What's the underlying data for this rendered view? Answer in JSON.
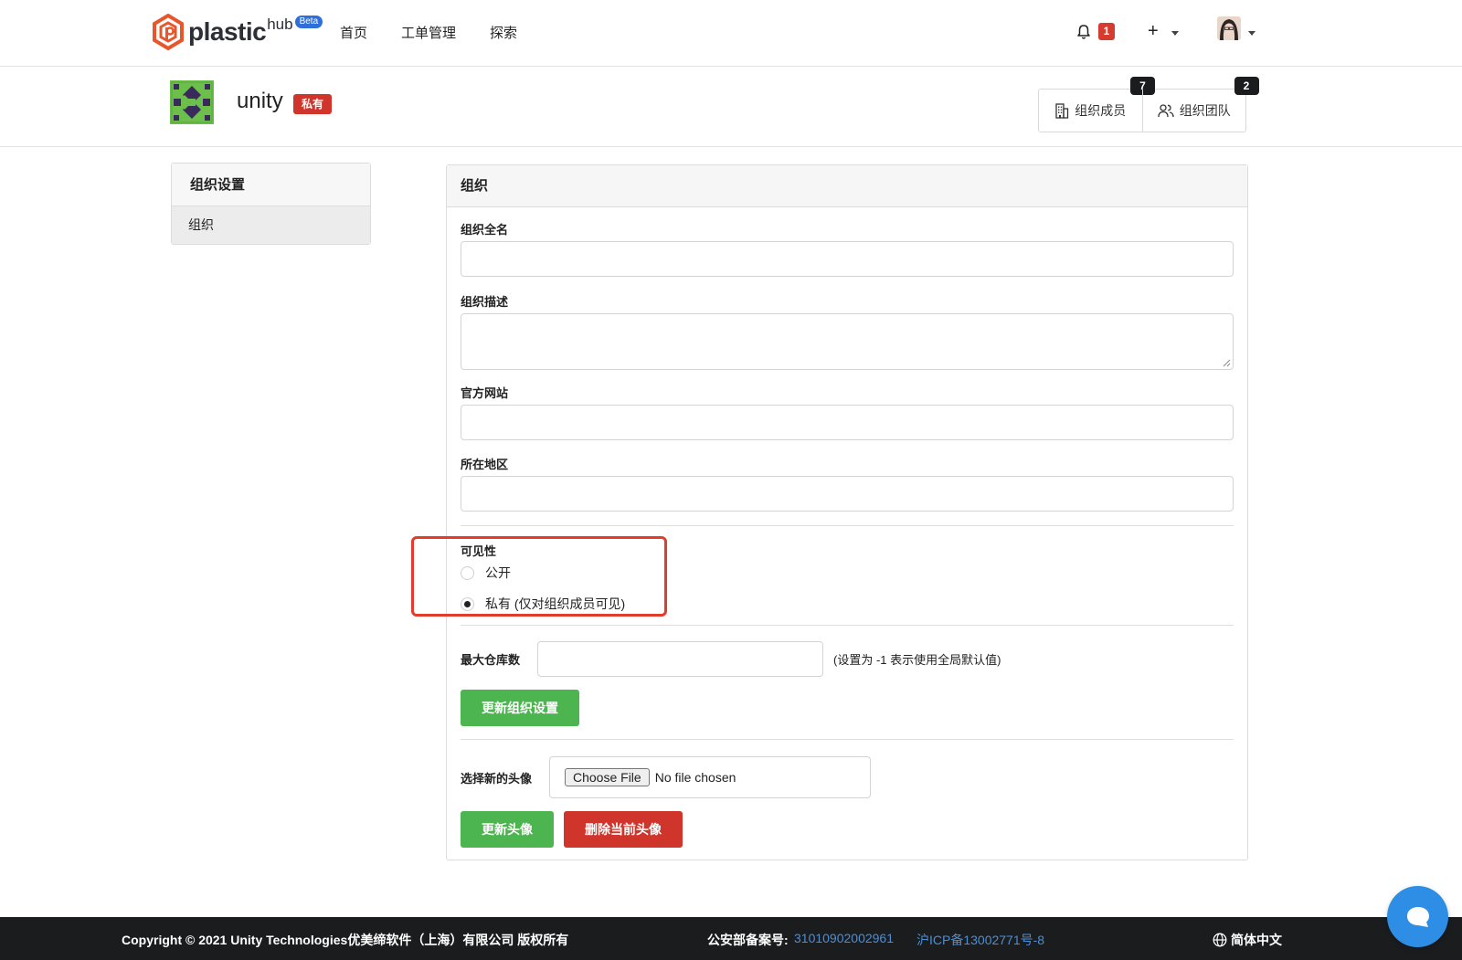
{
  "nav": {
    "logo_text": "plastic",
    "logo_hub": "hub",
    "logo_beta": "Beta",
    "links": [
      "首页",
      "工单管理",
      "探索"
    ],
    "notification_count": "1",
    "plus_symbol": "+"
  },
  "org": {
    "name": "unity",
    "visibility_badge": "私有",
    "members_label": "组织成员",
    "members_count": "7",
    "teams_label": "组织团队",
    "teams_count": "2"
  },
  "sidebar": {
    "heading": "组织设置",
    "items": [
      "组织"
    ]
  },
  "form": {
    "panel_title": "组织",
    "full_name_label": "组织全名",
    "full_name_value": "",
    "description_label": "组织描述",
    "description_value": "",
    "website_label": "官方网站",
    "website_value": "",
    "location_label": "所在地区",
    "location_value": "",
    "visibility_label": "可见性",
    "visibility_options": [
      "公开",
      "私有 (仅对组织成员可见)"
    ],
    "visibility_selected": "私有 (仅对组织成员可见)",
    "max_repos_label": "最大仓库数",
    "max_repos_value": "",
    "max_repos_hint": "(设置为 -1 表示使用全局默认值)",
    "update_settings_button": "更新组织设置",
    "avatar_label": "选择新的头像",
    "file_button": "Choose File",
    "file_status": "No file chosen",
    "update_avatar_button": "更新头像",
    "delete_avatar_button": "删除当前头像"
  },
  "footer": {
    "copyright": "Copyright © 2021 Unity Technologies优美缔软件（上海）有限公司 版权所有",
    "icp_label": "公安部备案号:",
    "icp_number": "31010902002961",
    "icp_record": "沪ICP备13002771号-8",
    "language": "简体中文"
  },
  "colors": {
    "accent_green": "#4db54f",
    "danger_red": "#d0352b",
    "footer_link_blue": "#4c8fd6",
    "highlight_red": "#e23c2c"
  }
}
